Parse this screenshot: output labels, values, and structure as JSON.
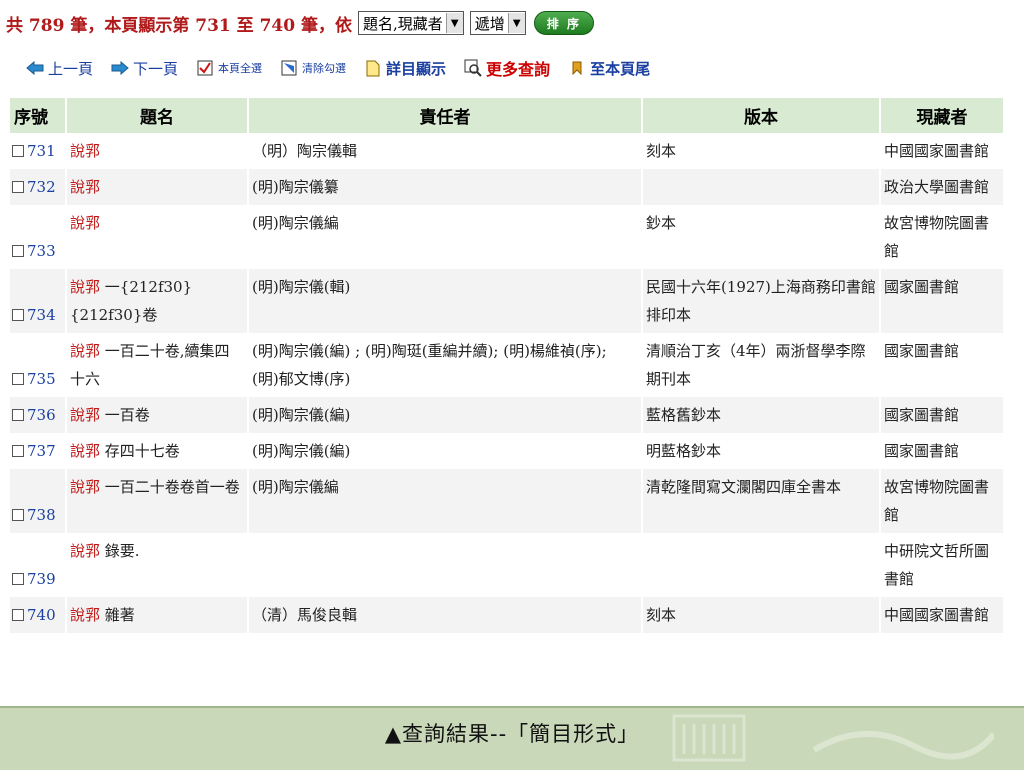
{
  "summary": {
    "text": "共 789 筆，本頁顯示第 731 至 740 筆，依",
    "sort_field": "題名,現藏者",
    "sort_order": "遞增",
    "sort_button": "排 序"
  },
  "toolbar": {
    "prev": "上一頁",
    "next": "下一頁",
    "select_all": "本頁全選",
    "clear": "清除勾選",
    "detail": "詳目顯示",
    "more_search": "更多查詢",
    "to_end": "至本頁尾"
  },
  "table": {
    "headers": [
      "序號",
      "題名",
      "責任者",
      "版本",
      "現藏者"
    ],
    "rows": [
      {
        "no": "731",
        "title": "說郛",
        "title_rest": "",
        "author": "（明）陶宗儀輯",
        "edition": "刻本",
        "holder": "中國國家圖書館"
      },
      {
        "no": "732",
        "title": "說郛",
        "title_rest": "",
        "author": "(明)陶宗儀纂",
        "edition": "",
        "holder": "政治大學圖書館"
      },
      {
        "no": "733",
        "title": "說郛",
        "title_rest": "",
        "author": "(明)陶宗儀編",
        "edition": "鈔本",
        "holder": "故宮博物院圖書館"
      },
      {
        "no": "734",
        "title": "說郛",
        "title_rest": " 一{212f30}{212f30}卷",
        "author": "(明)陶宗儀(輯)",
        "edition": "民國十六年(1927)上海商務印書館排印本",
        "holder": "國家圖書館"
      },
      {
        "no": "735",
        "title": "說郛",
        "title_rest": " 一百二十卷,續集四十六",
        "author": "(明)陶宗儀(編) ; (明)陶珽(重編并續); (明)楊維禎(序); (明)郁文博(序)",
        "edition": "清順治丁亥（4年）兩浙督學李際期刊本",
        "holder": "國家圖書館"
      },
      {
        "no": "736",
        "title": "說郛",
        "title_rest": " 一百卷",
        "author": "(明)陶宗儀(編)",
        "edition": "藍格舊鈔本",
        "holder": "國家圖書館"
      },
      {
        "no": "737",
        "title": "說郛",
        "title_rest": " 存四十七卷",
        "author": "(明)陶宗儀(編)",
        "edition": "明藍格鈔本",
        "holder": "國家圖書館"
      },
      {
        "no": "738",
        "title": "說郛",
        "title_rest": " 一百二十卷卷首一卷",
        "author": "(明)陶宗儀編",
        "edition": "清乾隆間寫文瀾閣四庫全書本",
        "holder": "故宮博物院圖書館"
      },
      {
        "no": "739",
        "title": "說郛",
        "title_rest": " 錄要.",
        "author": "",
        "edition": "",
        "holder": "中研院文哲所圖書館"
      },
      {
        "no": "740",
        "title": "說郛",
        "title_rest": " 雜著",
        "author": "（清）馬俊良輯",
        "edition": "刻本",
        "holder": "中國國家圖書館"
      }
    ]
  },
  "caption": "▲查詢結果--「簡目形式」"
}
